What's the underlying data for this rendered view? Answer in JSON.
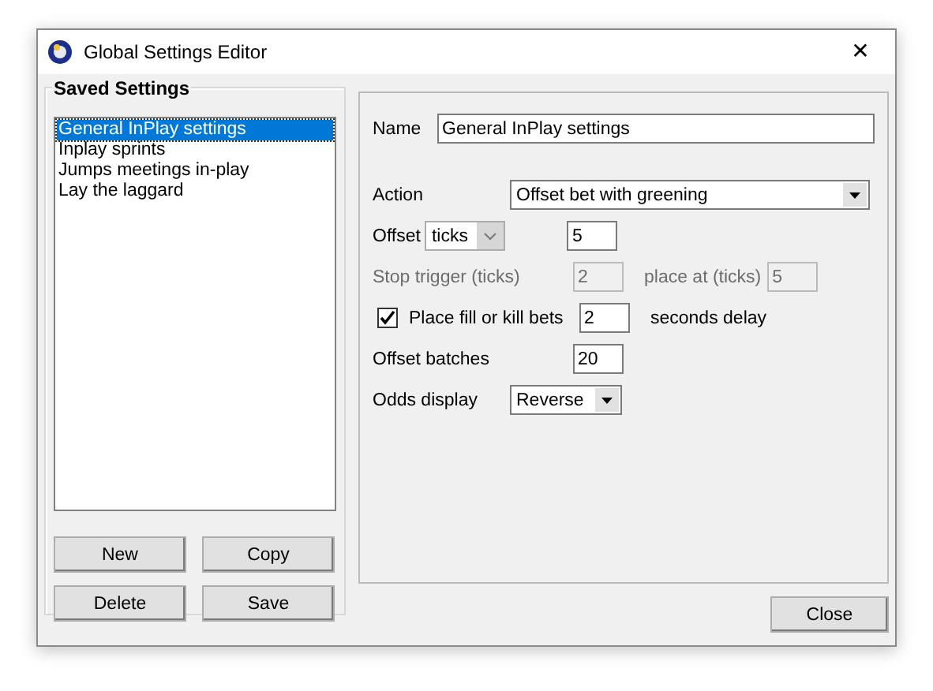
{
  "window": {
    "title": "Global Settings Editor",
    "close": "✕"
  },
  "saved_settings": {
    "title": "Saved Settings",
    "items": [
      {
        "label": "General InPlay settings",
        "selected": true
      },
      {
        "label": "Inplay sprints",
        "selected": false
      },
      {
        "label": "Jumps meetings in-play",
        "selected": false
      },
      {
        "label": "Lay the laggard",
        "selected": false
      }
    ],
    "buttons": [
      "New",
      "Copy",
      "Delete",
      "Save"
    ]
  },
  "form": {
    "name": {
      "label": "Name",
      "value": "General InPlay settings"
    },
    "action": {
      "label": "Action",
      "value": "Offset bet with greening"
    },
    "offset": {
      "label": "Offset",
      "unit": "ticks",
      "value": "5"
    },
    "stop_trigger": {
      "label": "Stop trigger (ticks)",
      "value": "2",
      "place_label": "place at (ticks)",
      "place_value": "5",
      "disabled": true
    },
    "fill_or_kill": {
      "label": "Place fill or kill bets",
      "checked": true,
      "value": "2",
      "suffix": "seconds delay"
    },
    "offset_batches": {
      "label": "Offset batches",
      "value": "20"
    },
    "odds_display": {
      "label": "Odds display",
      "value": "Reverse"
    }
  },
  "close_button": "Close"
}
